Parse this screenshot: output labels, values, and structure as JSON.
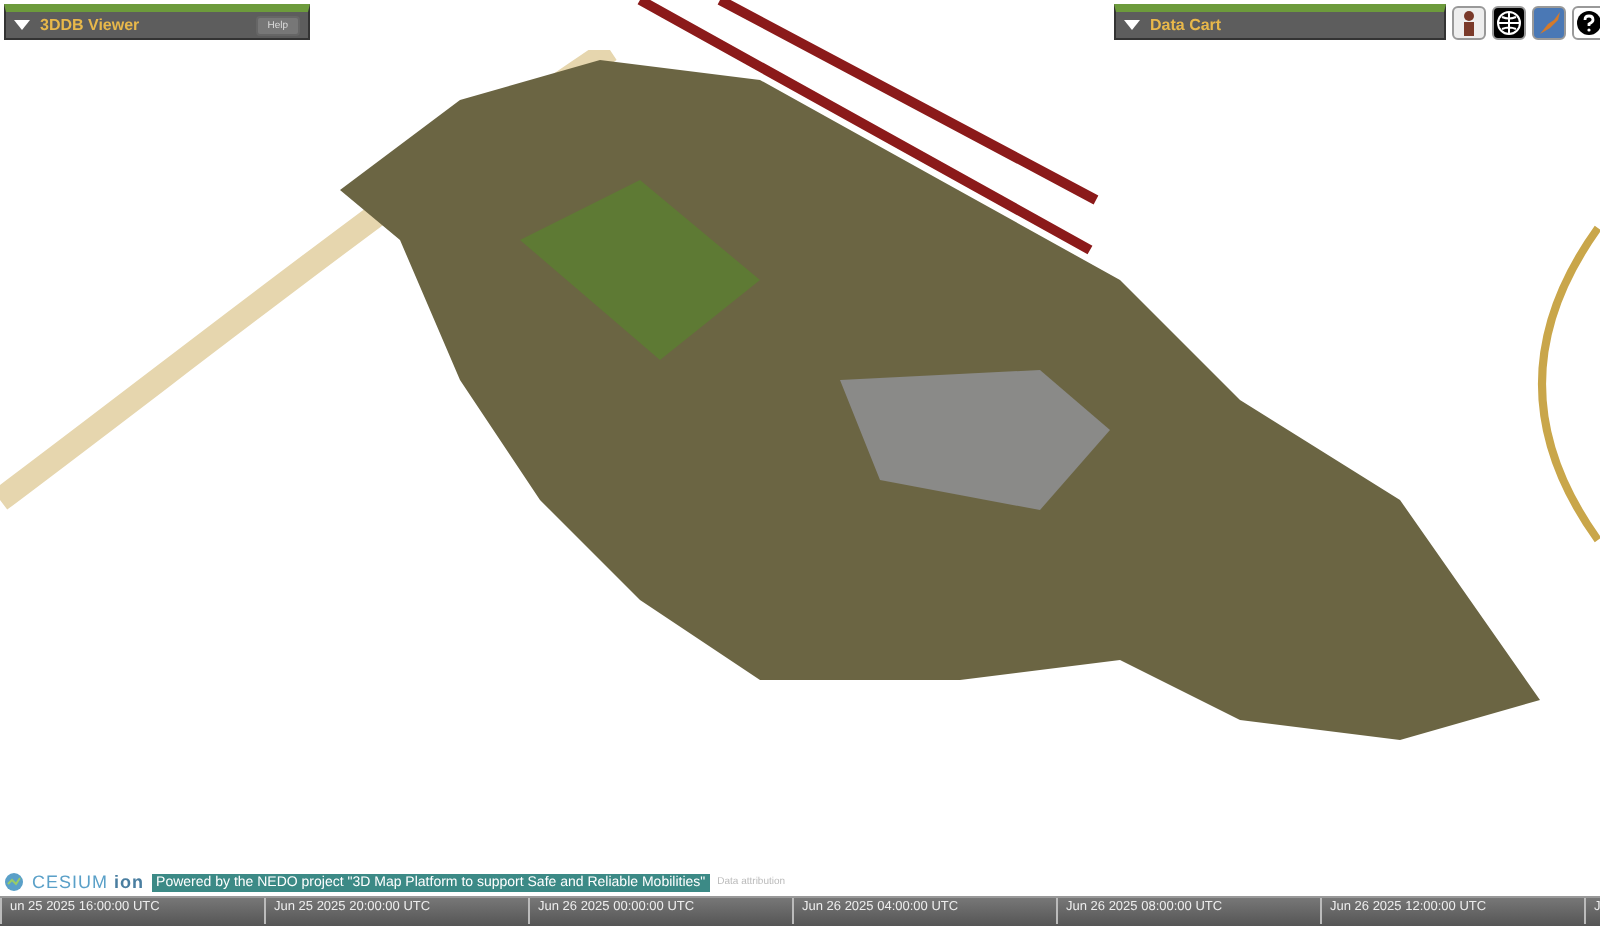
{
  "viewer_panel": {
    "title": "3DDB Viewer",
    "expanded": true,
    "help_button": "Help"
  },
  "cart_panel": {
    "title": "Data Cart",
    "expanded": true
  },
  "credits": {
    "logo_text": "CESIUM",
    "logo_suffix": "ion",
    "notice": "Powered by the NEDO project \"3D Map Platform to support Safe and Reliable Mobilities\"",
    "attribution_link": "Data attribution"
  },
  "timeline": {
    "labels": [
      "un 25 2025 16:00:00 UTC",
      "Jun 25 2025 20:00:00 UTC",
      "Jun 26 2025 00:00:00 UTC",
      "Jun 26 2025 04:00:00 UTC",
      "Jun 26 2025 08:00:00 UTC",
      "Jun 26 2025 12:00:00 UTC",
      "J"
    ]
  }
}
